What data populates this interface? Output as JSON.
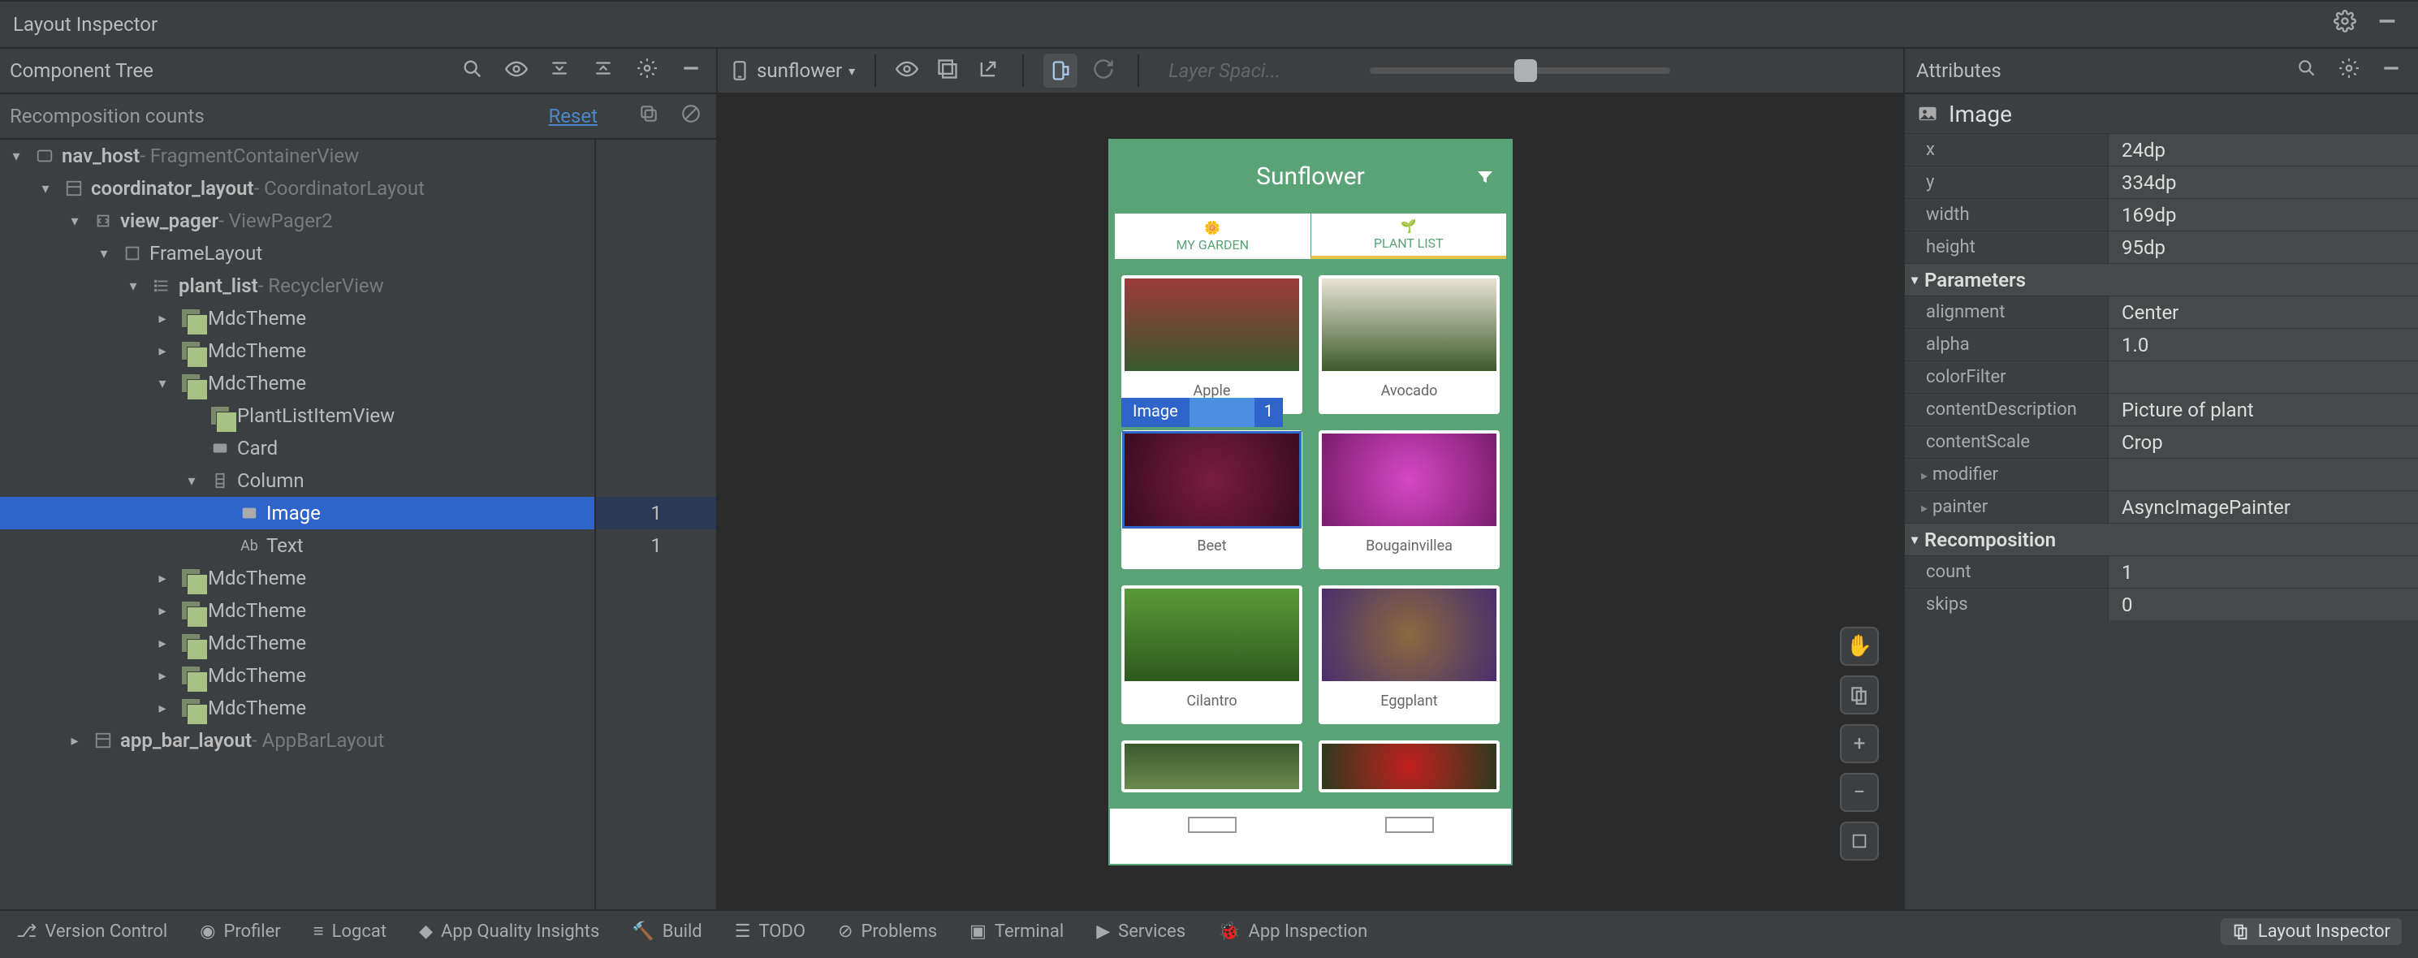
{
  "window": {
    "title": "Layout Inspector"
  },
  "left": {
    "panel_label": "Component Tree",
    "recomp_label": "Recomposition counts",
    "reset_label": "Reset",
    "tree": [
      {
        "depth": 0,
        "chev": "▾",
        "icon": "view",
        "label": "nav_host",
        "type": " - FragmentContainerView",
        "bold": true
      },
      {
        "depth": 1,
        "chev": "▾",
        "icon": "layout",
        "label": "coordinator_layout",
        "type": " - CoordinatorLayout",
        "bold": true
      },
      {
        "depth": 2,
        "chev": "▾",
        "icon": "pager",
        "label": "view_pager",
        "type": " - ViewPager2",
        "bold": true
      },
      {
        "depth": 3,
        "chev": "▾",
        "icon": "frame",
        "label": "FrameLayout",
        "type": ""
      },
      {
        "depth": 4,
        "chev": "▾",
        "icon": "list",
        "label": "plant_list",
        "type": " - RecyclerView",
        "bold": true
      },
      {
        "depth": 5,
        "chev": "▸",
        "icon": "compose",
        "label": "MdcTheme",
        "type": ""
      },
      {
        "depth": 5,
        "chev": "▸",
        "icon": "compose",
        "label": "MdcTheme",
        "type": ""
      },
      {
        "depth": 5,
        "chev": "▾",
        "icon": "compose",
        "label": "MdcTheme",
        "type": ""
      },
      {
        "depth": 6,
        "chev": "",
        "icon": "compose",
        "label": "PlantListItemView",
        "type": ""
      },
      {
        "depth": 6,
        "chev": "",
        "icon": "card",
        "label": "Card",
        "type": ""
      },
      {
        "depth": 6,
        "chev": "▾",
        "icon": "column",
        "label": "Column",
        "type": ""
      },
      {
        "depth": 7,
        "chev": "",
        "icon": "image",
        "label": "Image",
        "type": "",
        "selected": true,
        "count": "1"
      },
      {
        "depth": 7,
        "chev": "",
        "icon": "text",
        "label": "Text",
        "type": "",
        "count": "1"
      },
      {
        "depth": 5,
        "chev": "▸",
        "icon": "compose",
        "label": "MdcTheme",
        "type": ""
      },
      {
        "depth": 5,
        "chev": "▸",
        "icon": "compose",
        "label": "MdcTheme",
        "type": ""
      },
      {
        "depth": 5,
        "chev": "▸",
        "icon": "compose",
        "label": "MdcTheme",
        "type": ""
      },
      {
        "depth": 5,
        "chev": "▸",
        "icon": "compose",
        "label": "MdcTheme",
        "type": ""
      },
      {
        "depth": 5,
        "chev": "▸",
        "icon": "compose",
        "label": "MdcTheme",
        "type": ""
      },
      {
        "depth": 2,
        "chev": "▸",
        "icon": "layout",
        "label": "app_bar_layout",
        "type": " - AppBarLayout",
        "bold": true
      }
    ]
  },
  "center": {
    "device": "sunflower",
    "layer_label": "Layer Spaci...",
    "app_title": "Sunflower",
    "tab1": "MY GARDEN",
    "tab2": "PLANT LIST",
    "plants": [
      {
        "name": "Apple",
        "bg": "bg-apple"
      },
      {
        "name": "Avocado",
        "bg": "bg-avo"
      },
      {
        "name": "Beet",
        "bg": "bg-beet",
        "selected": true,
        "badge": "Image",
        "badge_n": "1"
      },
      {
        "name": "Bougainvillea",
        "bg": "bg-boug"
      },
      {
        "name": "Cilantro",
        "bg": "bg-cil"
      },
      {
        "name": "Eggplant",
        "bg": "bg-egg"
      }
    ]
  },
  "right": {
    "panel_label": "Attributes",
    "node_title": "Image",
    "basic": [
      {
        "name": "x",
        "value": "24dp"
      },
      {
        "name": "y",
        "value": "334dp"
      },
      {
        "name": "width",
        "value": "169dp"
      },
      {
        "name": "height",
        "value": "95dp"
      }
    ],
    "params_header": "Parameters",
    "params": [
      {
        "name": "alignment",
        "value": "Center"
      },
      {
        "name": "alpha",
        "value": "1.0"
      },
      {
        "name": "colorFilter",
        "value": ""
      },
      {
        "name": "contentDescription",
        "value": "Picture of plant"
      },
      {
        "name": "contentScale",
        "value": "Crop"
      },
      {
        "name": "modifier",
        "value": "",
        "expandable": true
      },
      {
        "name": "painter",
        "value": "AsyncImagePainter",
        "expandable": true
      }
    ],
    "recomp_header": "Recomposition",
    "recomp": [
      {
        "name": "count",
        "value": "1"
      },
      {
        "name": "skips",
        "value": "0"
      }
    ]
  },
  "bottom": {
    "items": [
      "Version Control",
      "Profiler",
      "Logcat",
      "App Quality Insights",
      "Build",
      "TODO",
      "Problems",
      "Terminal",
      "Services",
      "App Inspection"
    ],
    "active": "Layout Inspector"
  }
}
